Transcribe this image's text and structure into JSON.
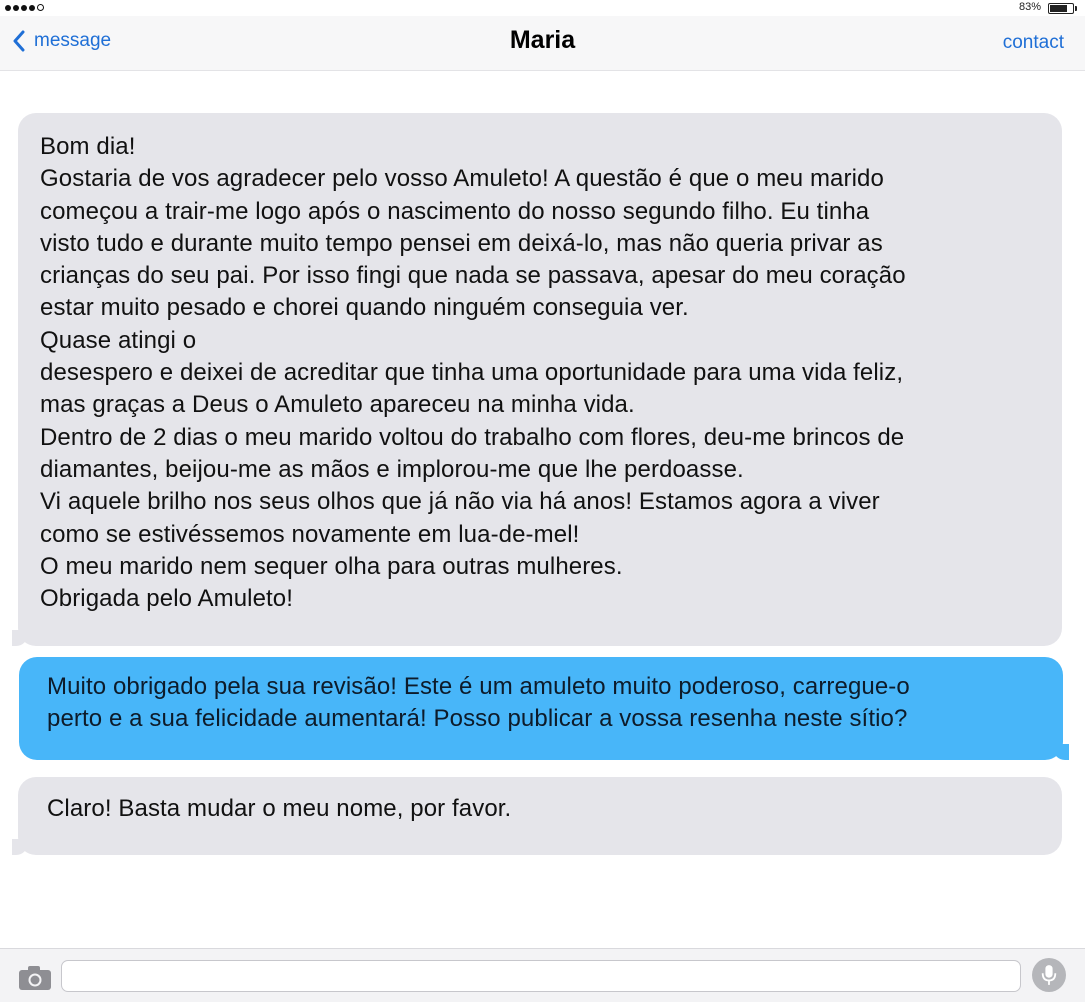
{
  "status_bar": {
    "battery_text": "83%",
    "battery_level": 0.83
  },
  "nav": {
    "back_label": "message",
    "title": "Maria",
    "contact_label": "contact",
    "accent_color": "#1f6fd6"
  },
  "messages": [
    {
      "direction": "incoming",
      "text": "Bom dia!\nGostaria de vos agradecer pelo vosso Amuleto! A questão é que o meu marido\ncomeçou a trair-me logo após o nascimento do nosso segundo filho. Eu tinha\nvisto tudo e durante muito tempo pensei em deixá-lo, mas não queria privar as\ncrianças do seu pai. Por isso fingi que nada se passava, apesar do meu coração\nestar muito pesado e chorei quando ninguém conseguia ver.\nQuase atingi o\ndesespero e deixei de acreditar que tinha uma oportunidade para uma vida feliz,\nmas graças a Deus o Amuleto apareceu na minha vida.\nDentro de 2 dias o meu marido voltou do trabalho com flores, deu-me brincos de\ndiamantes, beijou-me as mãos e implorou-me que lhe perdoasse.\nVi aquele brilho nos seus olhos que já não via há anos! Estamos agora a viver\ncomo se estivéssemos novamente em lua-de-mel!\nO meu marido nem sequer olha para outras mulheres.\nObrigada pelo Amuleto!"
    },
    {
      "direction": "outgoing",
      "text": "Muito obrigado pela sua revisão! Este é um amuleto muito poderoso, carregue-o\nperto e a sua felicidade aumentará! Posso publicar a vossa resenha neste sítio?"
    },
    {
      "direction": "incoming",
      "text": "Claro! Basta mudar o meu nome, por favor."
    }
  ],
  "colors": {
    "incoming_bubble": "#e5e5ea",
    "outgoing_bubble": "#48b6f9"
  },
  "input_bar": {
    "placeholder": "",
    "value": "",
    "camera_icon": "camera-icon",
    "mic_icon": "microphone-icon"
  }
}
